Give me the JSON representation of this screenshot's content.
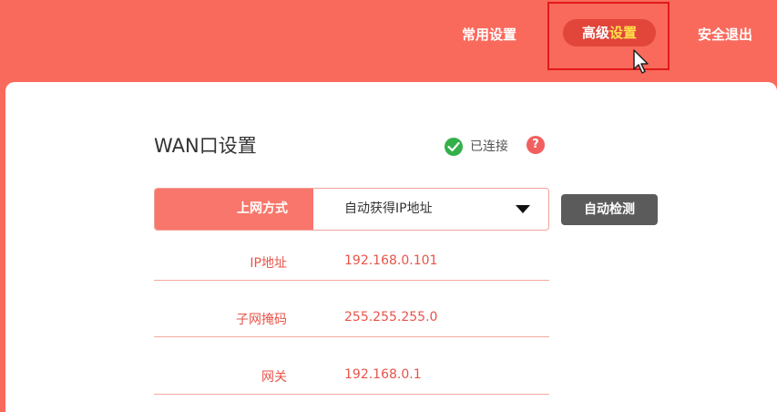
{
  "nav": {
    "common_settings": "常用设置",
    "advanced_prefix": "高级",
    "advanced_suffix": "设置",
    "logout": "安全退出"
  },
  "wan": {
    "title": "WAN口设置",
    "status": "已连接",
    "help_icon": "?",
    "method_label": "上网方式",
    "method_value": "自动获得IP地址",
    "detect_button": "自动检测",
    "fields": [
      {
        "label": "IP地址",
        "value": "192.168.0.101"
      },
      {
        "label": "子网掩码",
        "value": "255.255.255.0"
      },
      {
        "label": "网关",
        "value": "192.168.0.1"
      }
    ]
  },
  "colors": {
    "brand": "#fa6a5c",
    "accent_label": "#f8766b",
    "highlight_text": "#ffe04a",
    "connected": "#34b04a",
    "button_gray": "#5b5b5b"
  },
  "icons": [
    "check-circle-icon",
    "help-icon",
    "dropdown-arrow-icon",
    "mouse-pointer-icon"
  ]
}
